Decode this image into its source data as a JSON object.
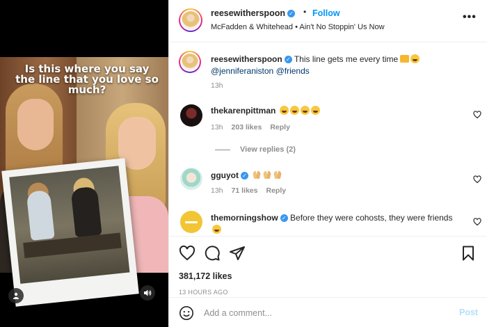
{
  "media": {
    "caption": "Is this where you say the line that you love so much?"
  },
  "header": {
    "username": "reesewitherspoon",
    "dot": "•",
    "follow_label": "Follow",
    "music": "McFadden & Whitehead • Ain't No Stoppin' Us Now",
    "more_label": "•••"
  },
  "caption_comment": {
    "username": "reesewitherspoon",
    "text": "This line gets me every time",
    "mentions": "@jenniferaniston @friends",
    "time": "13h"
  },
  "comments": [
    {
      "username": "thekarenpittman",
      "time": "13h",
      "likes": "203 likes",
      "reply": "Reply"
    },
    {
      "username": "gguyot",
      "time": "13h",
      "likes": "71 likes",
      "reply": "Reply"
    },
    {
      "username": "themorningshow",
      "text": "Before they were cohosts, they were friends"
    }
  ],
  "view_replies": "View replies (2)",
  "post": {
    "likes": "381,172 likes",
    "time_ago": "13 HOURS AGO"
  },
  "composer": {
    "placeholder": "Add a comment...",
    "post_label": "Post"
  },
  "icons": [
    "heart-icon",
    "comment-icon",
    "share-icon",
    "bookmark-icon",
    "emoji-icon",
    "user-tag-icon",
    "sound-icon",
    "more-icon",
    "verified-icon"
  ],
  "colors": {
    "accent": "#0095f6",
    "mention": "#00376b",
    "muted": "#8e8e8e",
    "post_disabled": "#b2dffc",
    "verified": "#3897f0"
  }
}
